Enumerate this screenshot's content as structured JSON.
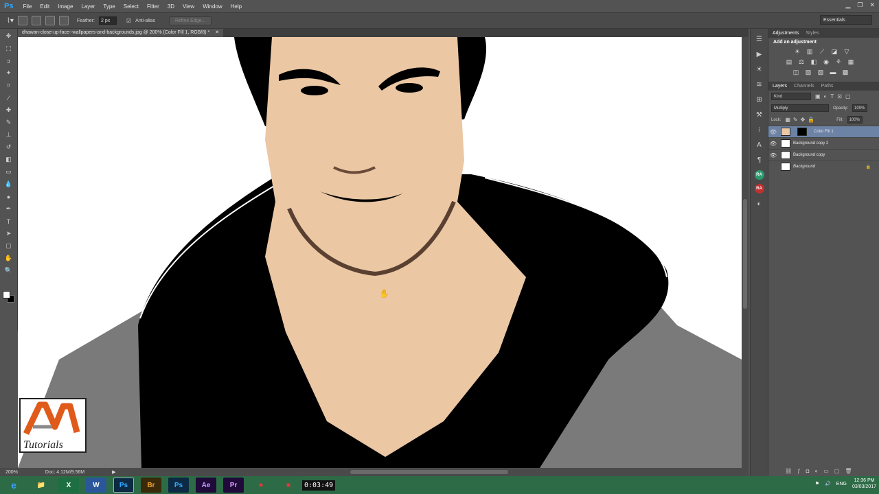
{
  "app": {
    "logo": "Ps"
  },
  "menu": [
    "File",
    "Edit",
    "Image",
    "Layer",
    "Type",
    "Select",
    "Filter",
    "3D",
    "View",
    "Window",
    "Help"
  ],
  "options": {
    "feather_label": "Feather:",
    "feather_value": "2 px",
    "antialias_label": "Anti-alias",
    "refine_label": "Refine Edge...",
    "workspace": "Essentials"
  },
  "document": {
    "tab_title": "dhawan-close-up-face--wallpapers-and-backgrounds.jpg @ 200% (Color Fill 1, RGB/8) *"
  },
  "status": {
    "zoom": "200%",
    "doc": "Doc: 4.12M/9.56M"
  },
  "adjustments": {
    "tab1": "Adjustments",
    "tab2": "Styles",
    "title": "Add an adjustment"
  },
  "layers_panel": {
    "tabs": [
      "Layers",
      "Channels",
      "Paths"
    ],
    "kind": "Kind",
    "blend_mode": "Multiply",
    "opacity_label": "Opacity:",
    "opacity": "100%",
    "lock_label": "Lock:",
    "fill_label": "Fill:",
    "fill": "100%",
    "layers": [
      {
        "name": "Color Fill 1",
        "selected": true
      },
      {
        "name": "Background copy 2",
        "selected": false
      },
      {
        "name": "Background copy",
        "selected": false
      },
      {
        "name": "Background",
        "selected": false
      }
    ]
  },
  "watermark": {
    "text": "Tutorials"
  },
  "taskbar": {
    "apps": [
      "e",
      "📁",
      "X",
      "W",
      "Ps",
      "Br",
      "Ps",
      "Ae",
      "Pr"
    ],
    "recorder": "0:03:49",
    "lang": "ENG",
    "time": "12:36 PM",
    "date": "03/03/2017"
  },
  "colors": {
    "skin": "#ebc7a4",
    "selection": "#6d83a6",
    "taskbar": "#2d6b46",
    "ps_blue": "#31a8ff"
  }
}
